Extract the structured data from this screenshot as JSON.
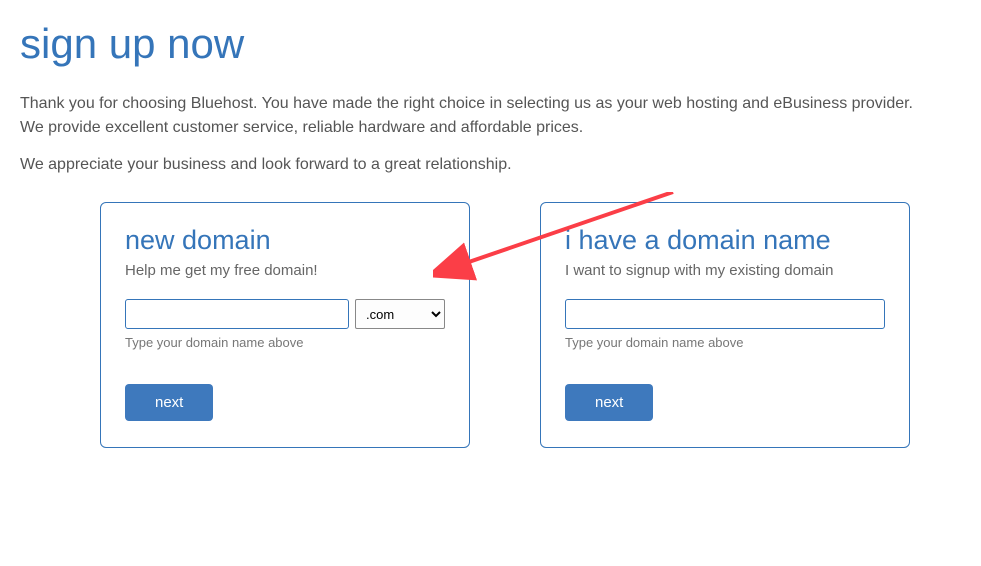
{
  "page": {
    "title": "sign up now",
    "intro": "Thank you for choosing Bluehost. You have made the right choice in selecting us as your web hosting and eBusiness provider. We provide excellent customer service, reliable hardware and affordable prices.",
    "secondary": "We appreciate your business and look forward to a great relationship."
  },
  "new_domain": {
    "title": "new domain",
    "subtitle": "Help me get my free domain!",
    "input_value": "",
    "input_placeholder": "",
    "tld_selected": ".com",
    "helper": "Type your domain name above",
    "button_label": "next"
  },
  "have_domain": {
    "title": "i have a domain name",
    "subtitle": "I want to signup with my existing domain",
    "input_value": "",
    "input_placeholder": "",
    "helper": "Type your domain name above",
    "button_label": "next"
  },
  "colors": {
    "accent": "#3575b9",
    "button": "#3e79bd",
    "annotation": "#fb3e47"
  }
}
